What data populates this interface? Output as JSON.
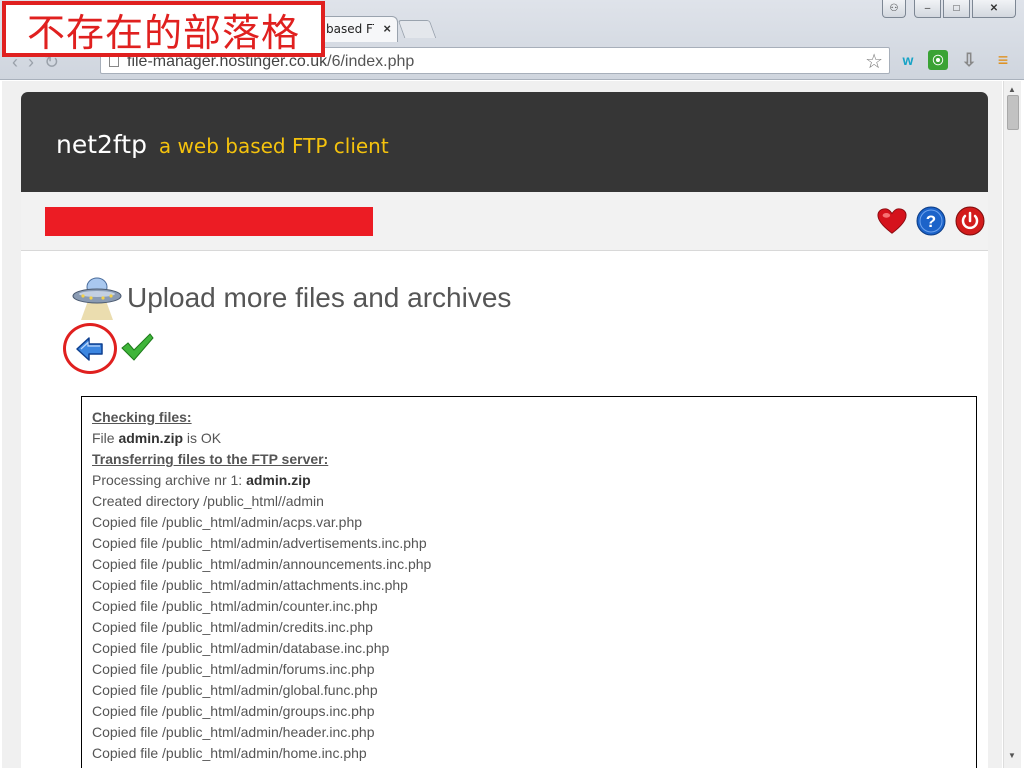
{
  "browser": {
    "tab_title": "based FT",
    "tab_close": "×",
    "window_controls": {
      "user": "⚇",
      "minimize": "–",
      "maximize": "□",
      "close": "✕"
    },
    "url_host": "file-manager.hostinger.co.uk",
    "url_path": "/6/index.php",
    "star": "☆",
    "extensions": {
      "w": "w",
      "g": "⦿",
      "d": "⇩",
      "menu": "≡"
    }
  },
  "blog_label": "不存在的部落格",
  "header": {
    "brand": "net2ftp",
    "tagline": "a web based FTP client"
  },
  "page": {
    "title": "Upload more files and archives"
  },
  "log": {
    "checking_heading": "Checking files:",
    "file_prefix": "File",
    "file_name": "admin.zip",
    "file_status": "is OK",
    "transfer_heading": "Transferring files to the FTP server:",
    "processing_prefix": "Processing archive nr 1:",
    "processing_name": "admin.zip",
    "lines": [
      "Created directory /public_html//admin",
      "Copied file /public_html/admin/acps.var.php",
      "Copied file /public_html/admin/advertisements.inc.php",
      "Copied file /public_html/admin/announcements.inc.php",
      "Copied file /public_html/admin/attachments.inc.php",
      "Copied file /public_html/admin/counter.inc.php",
      "Copied file /public_html/admin/credits.inc.php",
      "Copied file /public_html/admin/database.inc.php",
      "Copied file /public_html/admin/forums.inc.php",
      "Copied file /public_html/admin/global.func.php",
      "Copied file /public_html/admin/groups.inc.php",
      "Copied file /public_html/admin/header.inc.php",
      "Copied file /public_html/admin/home.inc.php"
    ]
  },
  "colors": {
    "header_bg": "#363636",
    "tagline": "#f4c20d",
    "annotation_red": "#e0201f"
  },
  "icons": {
    "heart": "heart-icon",
    "help": "help-icon",
    "power": "power-icon",
    "ufo": "ufo-icon",
    "back": "back-arrow-icon",
    "ok": "checkmark-icon"
  }
}
